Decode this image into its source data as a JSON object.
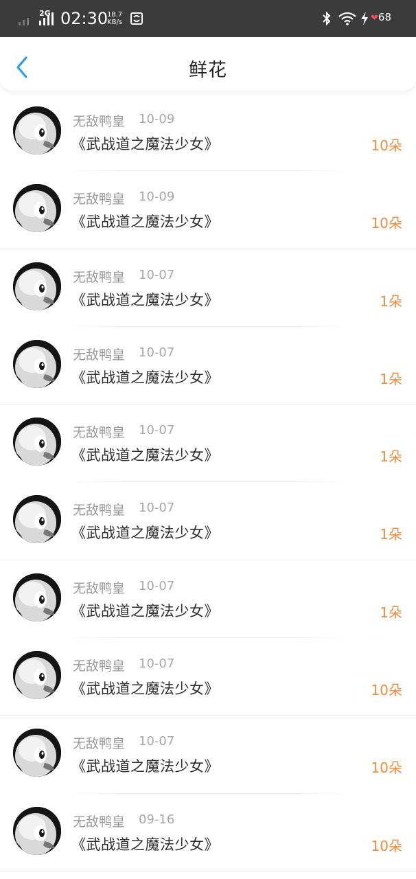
{
  "status_bar": {
    "network": "2G",
    "time": "02:30",
    "speed_value": "18.7",
    "speed_unit": "KB/s",
    "battery": "68",
    "icons": [
      "signal-icon",
      "sync-icon",
      "bluetooth-icon",
      "wifi-icon",
      "charging-icon",
      "heart-battery-icon"
    ]
  },
  "header": {
    "back_icon": "chevron-left-icon",
    "title": "鲜花"
  },
  "colors": {
    "accent": "#2f9ae8",
    "count": "#f08a3c",
    "status_bar_bg": "#3b3b3b"
  },
  "items": [
    {
      "user": "无敌鸭皇",
      "date": "10-09",
      "book": "《武战道之魔法少女》",
      "count": "10朵"
    },
    {
      "user": "无敌鸭皇",
      "date": "10-09",
      "book": "《武战道之魔法少女》",
      "count": "10朵"
    },
    {
      "user": "无敌鸭皇",
      "date": "10-07",
      "book": "《武战道之魔法少女》",
      "count": "1朵"
    },
    {
      "user": "无敌鸭皇",
      "date": "10-07",
      "book": "《武战道之魔法少女》",
      "count": "1朵"
    },
    {
      "user": "无敌鸭皇",
      "date": "10-07",
      "book": "《武战道之魔法少女》",
      "count": "1朵"
    },
    {
      "user": "无敌鸭皇",
      "date": "10-07",
      "book": "《武战道之魔法少女》",
      "count": "1朵"
    },
    {
      "user": "无敌鸭皇",
      "date": "10-07",
      "book": "《武战道之魔法少女》",
      "count": "1朵"
    },
    {
      "user": "无敌鸭皇",
      "date": "10-07",
      "book": "《武战道之魔法少女》",
      "count": "10朵"
    },
    {
      "user": "无敌鸭皇",
      "date": "10-07",
      "book": "《武战道之魔法少女》",
      "count": "10朵"
    },
    {
      "user": "无敌鸭皇",
      "date": "09-16",
      "book": "《武战道之魔法少女》",
      "count": "10朵"
    }
  ]
}
